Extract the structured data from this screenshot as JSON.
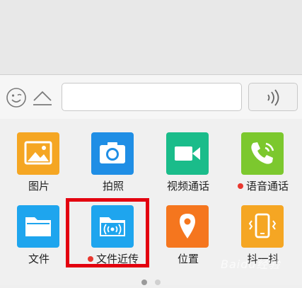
{
  "input_bar": {
    "emoji_icon": "emoji-face-icon",
    "keyboard_icon": "chevron-up-icon",
    "text_value": "",
    "voice_icon": "voice-wave-icon"
  },
  "apps": [
    {
      "label": "图片",
      "icon": "image-icon",
      "color": "#f5a623",
      "badge": false
    },
    {
      "label": "拍照",
      "icon": "camera-icon",
      "color": "#1f8ee5",
      "badge": false
    },
    {
      "label": "视频通话",
      "icon": "video-call-icon",
      "color": "#1abc8a",
      "badge": false
    },
    {
      "label": "语音通话",
      "icon": "phone-call-icon",
      "color": "#7cc82e",
      "badge": true
    },
    {
      "label": "文件",
      "icon": "folder-icon",
      "color": "#1ea5ee",
      "badge": false
    },
    {
      "label": "文件近传",
      "icon": "folder-broadcast-icon",
      "color": "#1ea5ee",
      "badge": true
    },
    {
      "label": "位置",
      "icon": "location-pin-icon",
      "color": "#f5761e",
      "badge": false
    },
    {
      "label": "抖一抖",
      "icon": "shake-phone-icon",
      "color": "#f5a623",
      "badge": false
    }
  ],
  "pager": {
    "pages": 2,
    "current": 1
  },
  "highlight_color": "#e3000f",
  "watermark": "Baidu经验"
}
